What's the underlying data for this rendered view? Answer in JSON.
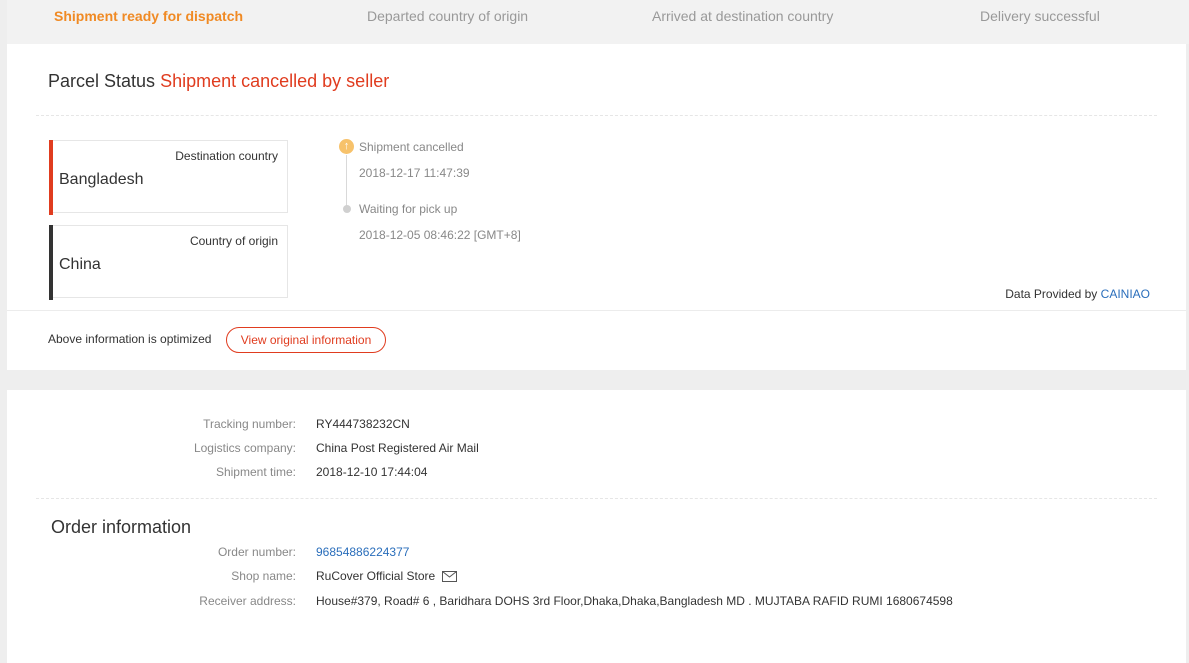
{
  "steps": [
    {
      "label": "Shipment ready for dispatch",
      "active": true
    },
    {
      "label": "Departed country of origin",
      "active": false
    },
    {
      "label": "Arrived at destination country",
      "active": false
    },
    {
      "label": "Delivery successful",
      "active": false
    }
  ],
  "parcel": {
    "status_label": "Parcel Status",
    "status_value": "Shipment cancelled by seller"
  },
  "countries": {
    "destination_label": "Destination country",
    "destination_value": "Bangladesh",
    "origin_label": "Country of origin",
    "origin_value": "China"
  },
  "timeline": [
    {
      "title": "Shipment cancelled",
      "time": "2018-12-17 11:47:39",
      "icon": "arrow-up-icon"
    },
    {
      "title": "Waiting for pick up",
      "time": "2018-12-05 08:46:22 [GMT+8]",
      "icon": "dot-icon"
    }
  ],
  "provider": {
    "prefix": "Data Provided by",
    "name": "CAINIAO"
  },
  "optimized": {
    "text": "Above information is optimized",
    "button": "View original information"
  },
  "shipment": {
    "tracking_label": "Tracking number:",
    "tracking_value": "RY444738232CN",
    "company_label": "Logistics company:",
    "company_value": "China Post Registered Air Mail",
    "time_label": "Shipment time:",
    "time_value": "2018-12-10 17:44:04"
  },
  "order": {
    "title": "Order information",
    "number_label": "Order number:",
    "number_value": "96854886224377",
    "shop_label": "Shop name:",
    "shop_value": "RuCover Official Store",
    "address_label": "Receiver address:",
    "address_value": "House#379, Road# 6 , Baridhara DOHS 3rd Floor,Dhaka,Dhaka,Bangladesh MD . MUJTABA RAFID RUMI 1680674598"
  },
  "colors": {
    "accent_orange": "#f08a24",
    "cancel_red": "#e03c1f",
    "link_blue": "#2a6ebb",
    "destination_bar": "#e03c1f",
    "origin_bar": "#333333"
  }
}
